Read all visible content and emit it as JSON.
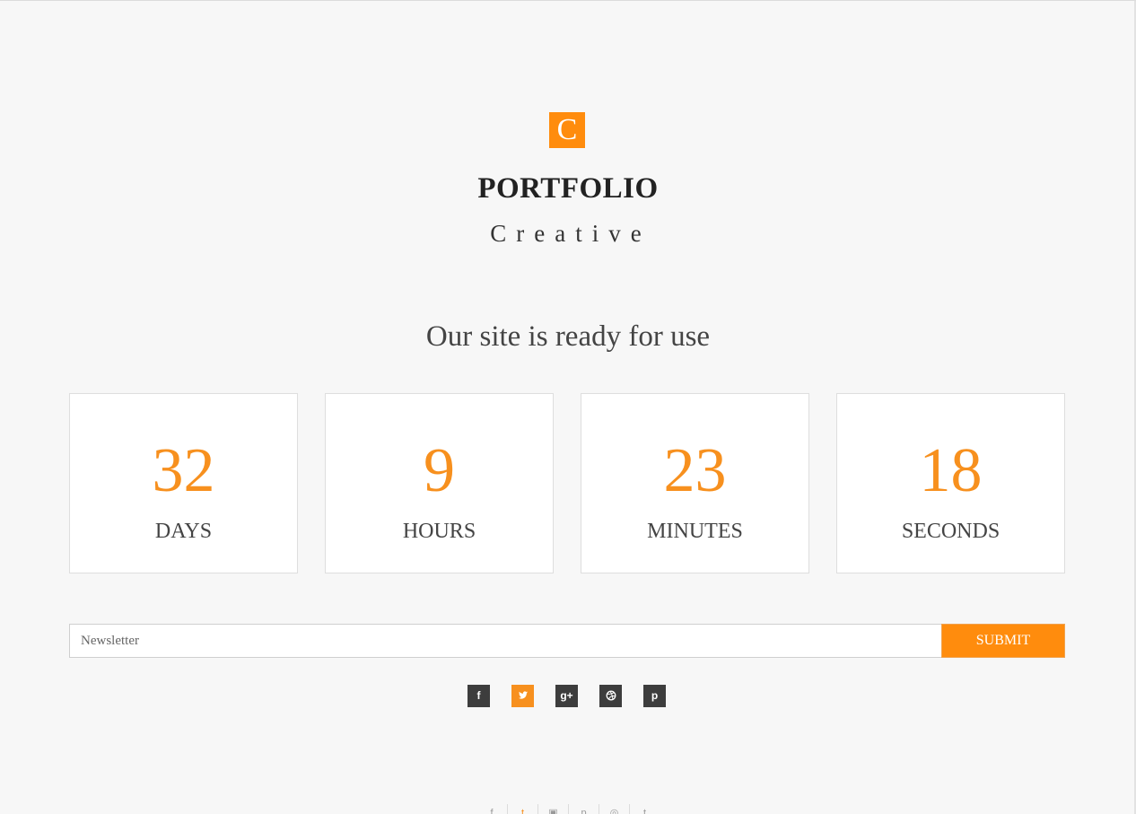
{
  "brand": {
    "logo_letter": "C",
    "name": "PORTFOLIO",
    "tagline": "Creative"
  },
  "headline": "Our site is ready for use",
  "countdown": [
    {
      "value": "32",
      "label": "DAYS"
    },
    {
      "value": "9",
      "label": "HOURS"
    },
    {
      "value": "23",
      "label": "MINUTES"
    },
    {
      "value": "18",
      "label": "SECONDS"
    }
  ],
  "newsletter": {
    "placeholder": "Newsletter",
    "submit_label": "SUBMIT"
  },
  "social": [
    {
      "icon": "facebook-icon",
      "glyph": "f"
    },
    {
      "icon": "twitter-icon",
      "glyph": "t"
    },
    {
      "icon": "google-plus-icon",
      "glyph": "g+"
    },
    {
      "icon": "dribbble-icon",
      "glyph": ""
    },
    {
      "icon": "pinterest-icon",
      "glyph": "p"
    }
  ],
  "footer_icons": [
    {
      "icon": "facebook-icon",
      "glyph": "f"
    },
    {
      "icon": "twitter-icon",
      "glyph": "t"
    },
    {
      "icon": "instagram-icon",
      "glyph": "▣"
    },
    {
      "icon": "pinterest-icon",
      "glyph": "p"
    },
    {
      "icon": "dribbble-icon",
      "glyph": "◎"
    },
    {
      "icon": "tumblr-icon",
      "glyph": "t"
    }
  ],
  "colors": {
    "accent": "#ff8c0d",
    "dark_icon_bg": "#3d3d3d",
    "background": "#f7f7f7"
  }
}
